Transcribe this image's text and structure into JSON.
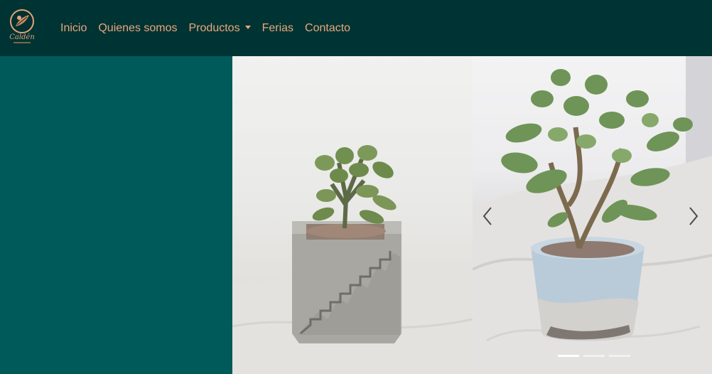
{
  "brand": {
    "name": "Caldén",
    "icon": "leaf-logo-icon"
  },
  "nav": {
    "items": [
      {
        "label": "Inicio"
      },
      {
        "label": "Quienes somos"
      },
      {
        "label": "Productos",
        "dropdown": true
      },
      {
        "label": "Ferias"
      },
      {
        "label": "Contacto"
      }
    ]
  },
  "carousel": {
    "prev_icon": "chevron-left-icon",
    "next_icon": "chevron-right-icon",
    "indicator_count": 3,
    "active_index": 0
  },
  "colors": {
    "navbar_bg": "#003333",
    "accent": "#e9a77b",
    "panel_bg": "#005a5a"
  }
}
